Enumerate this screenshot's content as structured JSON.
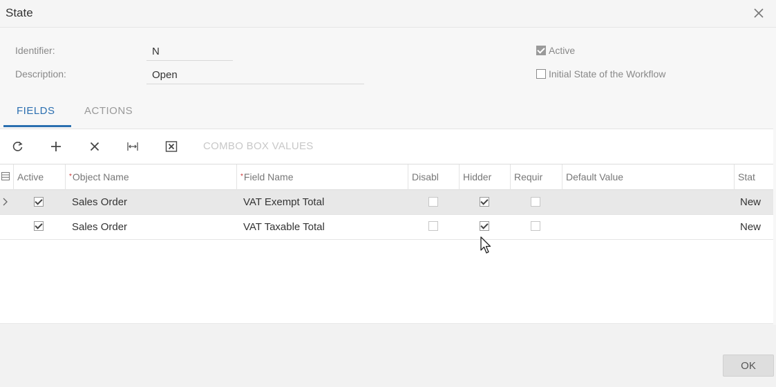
{
  "dialog": {
    "title": "State"
  },
  "form": {
    "identifier_label": "Identifier:",
    "identifier_value": "N",
    "description_label": "Description:",
    "description_value": "Open",
    "active_label": "Active",
    "active_checked": true,
    "initial_state_label": "Initial State of the Workflow",
    "initial_state_checked": false
  },
  "tabs": [
    {
      "label": "FIELDS",
      "active": true
    },
    {
      "label": "ACTIONS",
      "active": false
    }
  ],
  "toolbar": {
    "refresh_icon": "refresh-icon",
    "add_icon": "plus-icon",
    "delete_icon": "x-icon",
    "fit_icon": "fit-columns-icon",
    "excel_icon": "excel-export-icon",
    "combo_box_label": "COMBO BOX VALUES"
  },
  "grid": {
    "columns": [
      "Active",
      "Object Name",
      "Field Name",
      "Disabl",
      "Hidder",
      "Requir",
      "Default Value",
      "Stat"
    ],
    "required_columns": [
      "Object Name",
      "Field Name"
    ],
    "rows": [
      {
        "active": true,
        "object_name": "Sales Order",
        "field_name": "VAT Exempt Total",
        "disabled": false,
        "hidden": true,
        "required": false,
        "default_value": "",
        "status": "New",
        "selected": true
      },
      {
        "active": true,
        "object_name": "Sales Order",
        "field_name": "VAT Taxable Total",
        "disabled": false,
        "hidden": true,
        "required": false,
        "default_value": "",
        "status": "New",
        "selected": false
      }
    ]
  },
  "footer": {
    "ok_label": "OK"
  }
}
